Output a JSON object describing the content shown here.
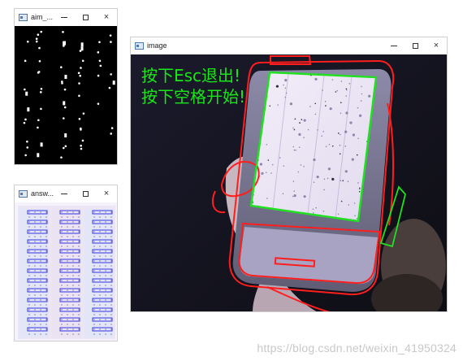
{
  "windows": {
    "aim": {
      "title": "aim_...",
      "controls": {
        "minimize": "–",
        "maximize": "□",
        "close": "×"
      }
    },
    "answer": {
      "title": "answ...",
      "controls": {
        "minimize": "–",
        "maximize": "□",
        "close": "×"
      }
    },
    "image": {
      "title": "image",
      "controls": {
        "minimize": "–",
        "maximize": "□",
        "close": "×"
      },
      "overlay_line1": "按下Esc退出!",
      "overlay_line2": "按下空格开始!"
    }
  },
  "colors": {
    "contour_red": "#ff1e1e",
    "sheet_green": "#21e021",
    "overlay_text": "#19e619",
    "box_blue": "#3434e0"
  },
  "watermark": "https://blog.csdn.net/weixin_41950324"
}
